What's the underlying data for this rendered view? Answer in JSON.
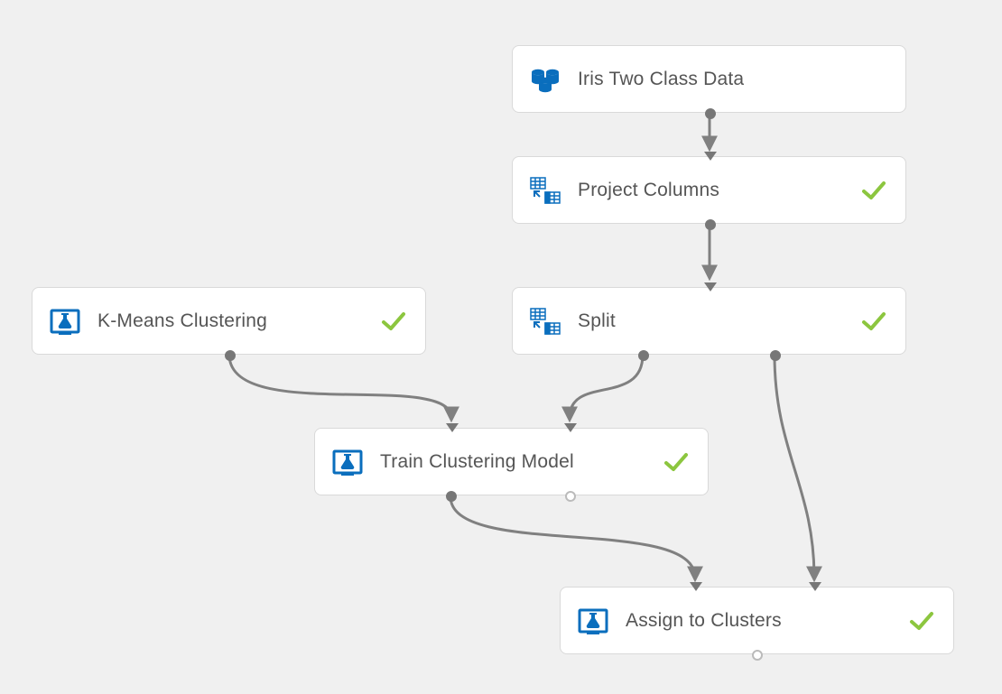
{
  "nodes": {
    "iris": {
      "label": "Iris Two Class Data"
    },
    "project": {
      "label": "Project Columns"
    },
    "kmeans": {
      "label": "K-Means Clustering"
    },
    "split": {
      "label": "Split"
    },
    "train": {
      "label": "Train Clustering Model"
    },
    "assign": {
      "label": "Assign to Clusters"
    }
  },
  "icons": {
    "database": "database-icon",
    "project_columns": "project-columns-icon",
    "experiment": "experiment-flask-icon",
    "split": "split-icon"
  },
  "colors": {
    "icon_blue": "#0a6ebd",
    "status_green": "#8cc63f",
    "connector": "#808080",
    "port_fill": "#777777",
    "node_border": "#d9d9d9",
    "canvas_bg": "#f0f0f0"
  },
  "status": {
    "iris": "none",
    "project": "success",
    "kmeans": "success",
    "split": "success",
    "train": "success",
    "assign": "success"
  }
}
